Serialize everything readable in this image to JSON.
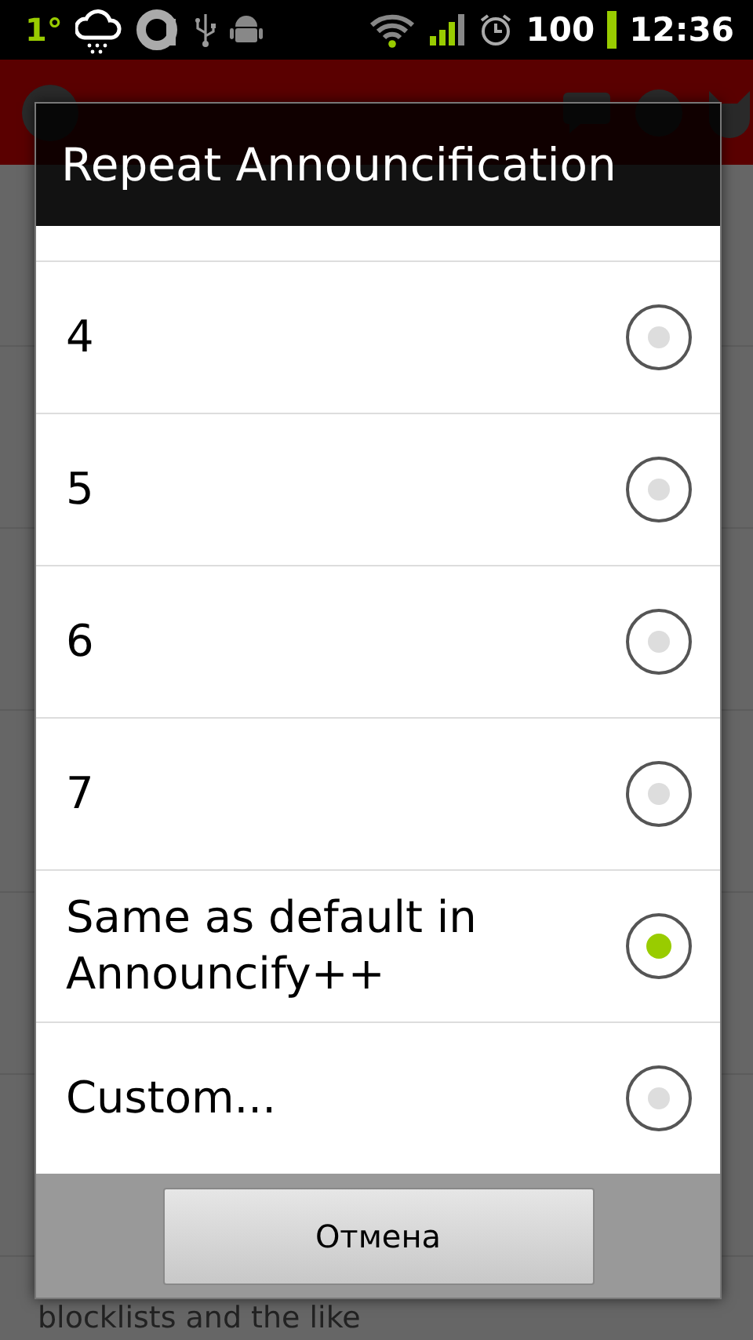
{
  "status_bar": {
    "temperature": "1°",
    "battery_percent": "100",
    "time": "12:36"
  },
  "background": {
    "texts": [
      "blocklists and the like"
    ]
  },
  "dialog": {
    "title": "Repeat Announcification",
    "options": [
      {
        "label": "4",
        "selected": false
      },
      {
        "label": "5",
        "selected": false
      },
      {
        "label": "6",
        "selected": false
      },
      {
        "label": "7",
        "selected": false
      },
      {
        "label": "Same as default in Announcify++",
        "selected": true
      },
      {
        "label": "Custom...",
        "selected": false
      }
    ],
    "buttons": [
      "Отмена"
    ]
  }
}
